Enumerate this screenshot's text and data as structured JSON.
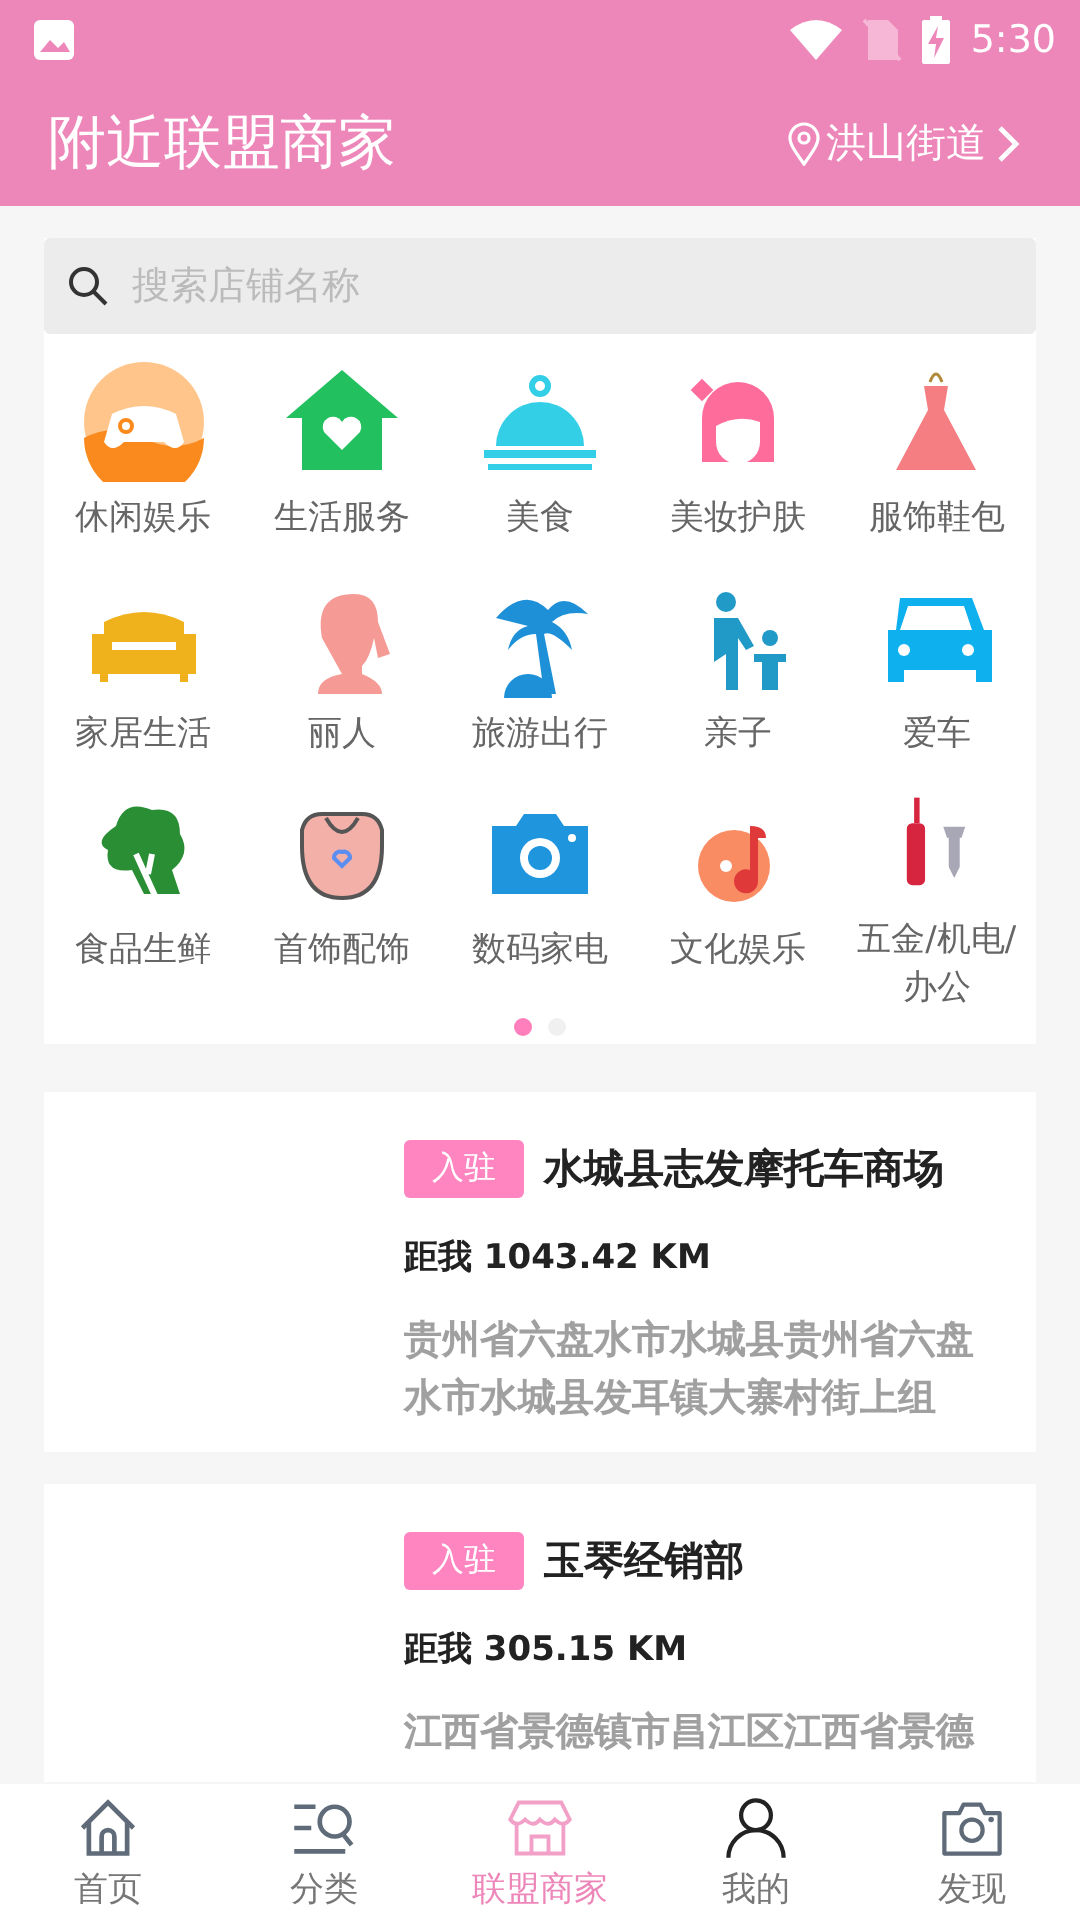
{
  "status_bar": {
    "time": "5:30"
  },
  "header": {
    "title": "附近联盟商家",
    "location": "洪山街道"
  },
  "search": {
    "placeholder": "搜索店铺名称"
  },
  "categories": [
    {
      "label": "休闲娱乐"
    },
    {
      "label": "生活服务"
    },
    {
      "label": "美食"
    },
    {
      "label": "美妆护肤"
    },
    {
      "label": "服饰鞋包"
    },
    {
      "label": "家居生活"
    },
    {
      "label": "丽人"
    },
    {
      "label": "旅游出行"
    },
    {
      "label": "亲子"
    },
    {
      "label": "爱车"
    },
    {
      "label": "食品生鲜"
    },
    {
      "label": "首饰配饰"
    },
    {
      "label": "数码家电"
    },
    {
      "label": "文化娱乐"
    },
    {
      "label": "五金/机电/办公"
    }
  ],
  "pages": [
    {
      "selected": true
    },
    {
      "selected": false
    }
  ],
  "merchants": [
    {
      "badge": "入驻",
      "name": "水城县志发摩托车商场",
      "distance": "距我 1043.42 KM",
      "address": "贵州省六盘水市水城县贵州省六盘水市水城县发耳镇大寨村街上组"
    },
    {
      "badge": "入驻",
      "name": "玉琴经销部",
      "distance": "距我 305.15 KM",
      "address": "江西省景德镇市昌江区江西省景德"
    }
  ],
  "tabs": [
    {
      "label": "首页",
      "selected": false
    },
    {
      "label": "分类",
      "selected": false
    },
    {
      "label": "联盟商家",
      "selected": true
    },
    {
      "label": "我的",
      "selected": false
    },
    {
      "label": "发现",
      "selected": false
    }
  ]
}
